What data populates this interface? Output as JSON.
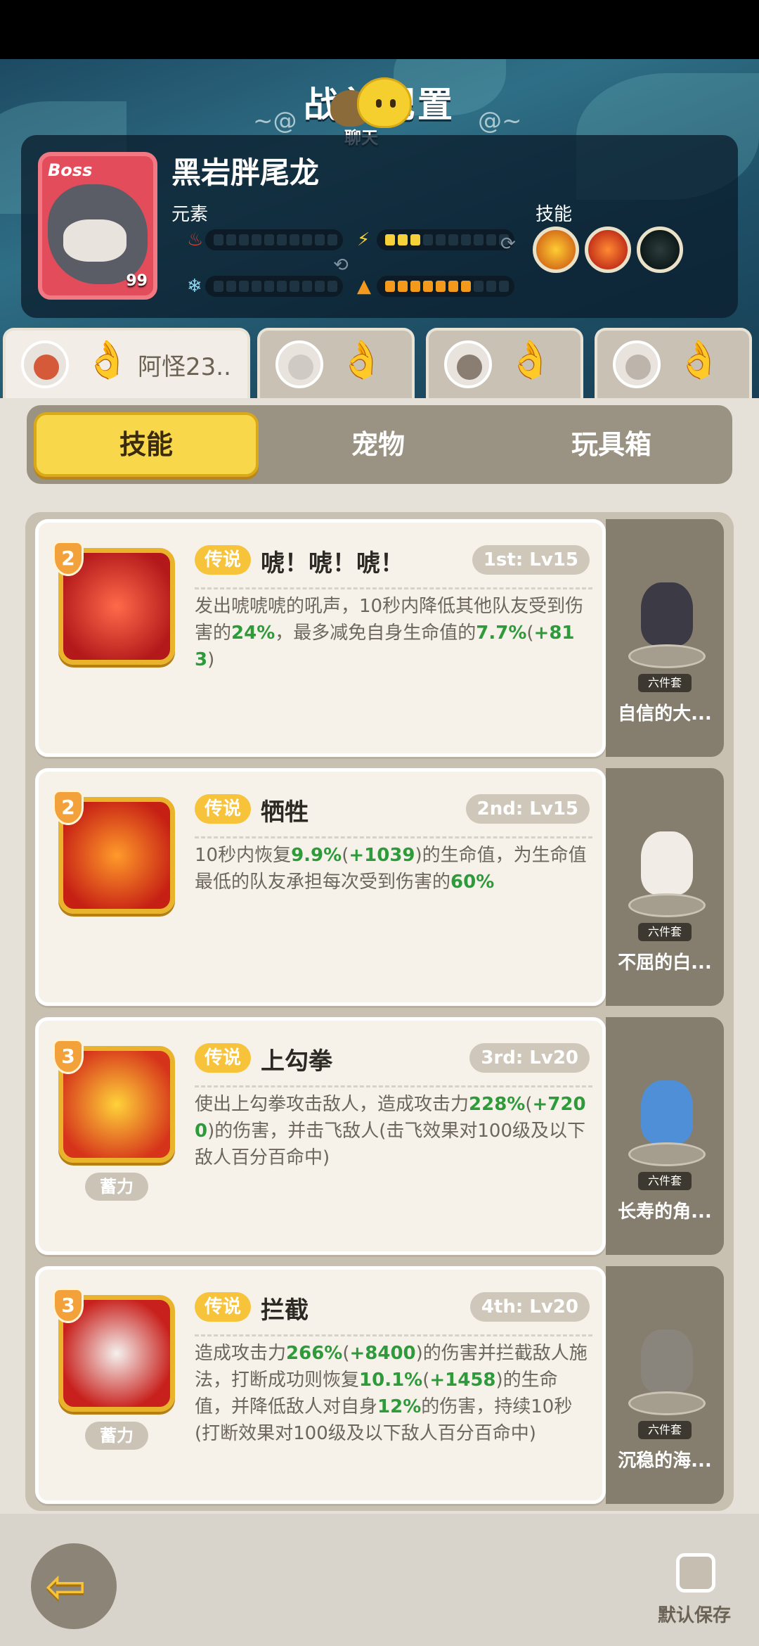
{
  "page": {
    "title": "战前配置",
    "chat_label": "聊天"
  },
  "boss": {
    "badge": "Boss",
    "name": "黑岩胖尾龙",
    "level": "99",
    "element_label": "元素",
    "skill_label": "技能",
    "meters": {
      "fire": {
        "filled": 0,
        "total": 10
      },
      "lightning": {
        "filled": 3,
        "total": 10
      },
      "ice": {
        "filled": 0,
        "total": 10
      },
      "earth": {
        "filled": 7,
        "total": 10
      }
    }
  },
  "party_tabs": [
    {
      "name": "阿怪23..",
      "active": true
    },
    {
      "name": "",
      "active": false
    },
    {
      "name": "",
      "active": false
    },
    {
      "name": "",
      "active": false
    }
  ],
  "segments": [
    {
      "label": "技能",
      "active": true
    },
    {
      "label": "宠物",
      "active": false
    },
    {
      "label": "玩具箱",
      "active": false
    }
  ],
  "skills": [
    {
      "level_badge": "2",
      "tag": "传说",
      "name": "唬！唬！唬！",
      "slot": "1st: Lv15",
      "desc": "发出唬唬唬的吼声，10秒内降低其他队友受到伤害的24%，最多减免自身生命值的7.7%(+813)",
      "charge": "",
      "pet": {
        "set": "六件套",
        "name": "自信的大..."
      }
    },
    {
      "level_badge": "2",
      "tag": "传说",
      "name": "牺牲",
      "slot": "2nd: Lv15",
      "desc": "10秒内恢复9.9%(+1039)的生命值，为生命值最低的队友承担每次受到伤害的60%",
      "charge": "",
      "pet": {
        "set": "六件套",
        "name": "不屈的白..."
      }
    },
    {
      "level_badge": "3",
      "tag": "传说",
      "name": "上勾拳",
      "slot": "3rd: Lv20",
      "desc": "使出上勾拳攻击敌人，造成攻击力228%(+7200)的伤害，并击飞敌人(击飞效果对100级及以下敌人百分百命中)",
      "charge": "蓄力",
      "pet": {
        "set": "六件套",
        "name": "长寿的角..."
      }
    },
    {
      "level_badge": "3",
      "tag": "传说",
      "name": "拦截",
      "slot": "4th: Lv20",
      "desc": "造成攻击力266%(+8400)的伤害并拦截敌人施法，打断成功则恢复10.1%(+1458)的生命值，并降低敌人对自身12%的伤害，持续10秒(打断效果对100级及以下敌人百分百命中)",
      "charge": "蓄力",
      "pet": {
        "set": "六件套",
        "name": "沉稳的海..."
      }
    }
  ],
  "footer": {
    "save_label": "默认保存"
  },
  "colors": {
    "accent_yellow": "#f8d84a",
    "green_value": "#2e9b3a",
    "header_teal": "#2f6f86"
  }
}
